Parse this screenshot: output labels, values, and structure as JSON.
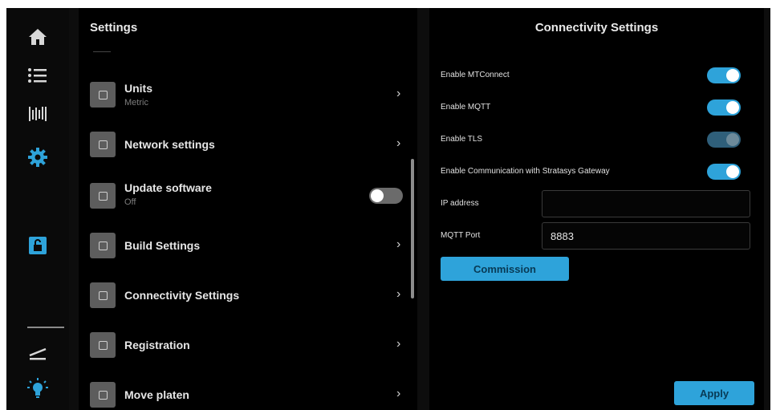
{
  "nav": {
    "items": [
      {
        "icon": "home-icon"
      },
      {
        "icon": "list-icon"
      },
      {
        "icon": "material-icon"
      },
      {
        "icon": "gear-icon"
      },
      {
        "icon": "unlock-icon"
      },
      {
        "icon": "platen-icon"
      },
      {
        "icon": "light-icon"
      }
    ],
    "accent": "#2ea3da"
  },
  "settings": {
    "title": "Settings",
    "items": [
      {
        "label": "Units",
        "sub": "Metric",
        "control": "chevron"
      },
      {
        "label": "Network settings",
        "control": "chevron"
      },
      {
        "label": "Update software",
        "sub": "Off",
        "control": "toggle-off"
      },
      {
        "label": "Build Settings",
        "control": "chevron"
      },
      {
        "label": "Connectivity Settings",
        "control": "chevron"
      },
      {
        "label": "Registration",
        "control": "chevron"
      },
      {
        "label": "Move platen",
        "control": "chevron"
      }
    ],
    "chevron": "›"
  },
  "connectivity": {
    "title": "Connectivity Settings",
    "toggles": [
      {
        "label": "Enable MTConnect",
        "state": "on"
      },
      {
        "label": "Enable MQTT",
        "state": "on"
      },
      {
        "label": "Enable TLS",
        "state": "on-disabled"
      },
      {
        "label": "Enable Communication with Stratasys Gateway",
        "state": "on"
      }
    ],
    "ip_label": "IP address",
    "ip_value": "",
    "port_label": "MQTT Port",
    "port_value": "8883",
    "commission_label": "Commission",
    "apply_label": "Apply"
  }
}
